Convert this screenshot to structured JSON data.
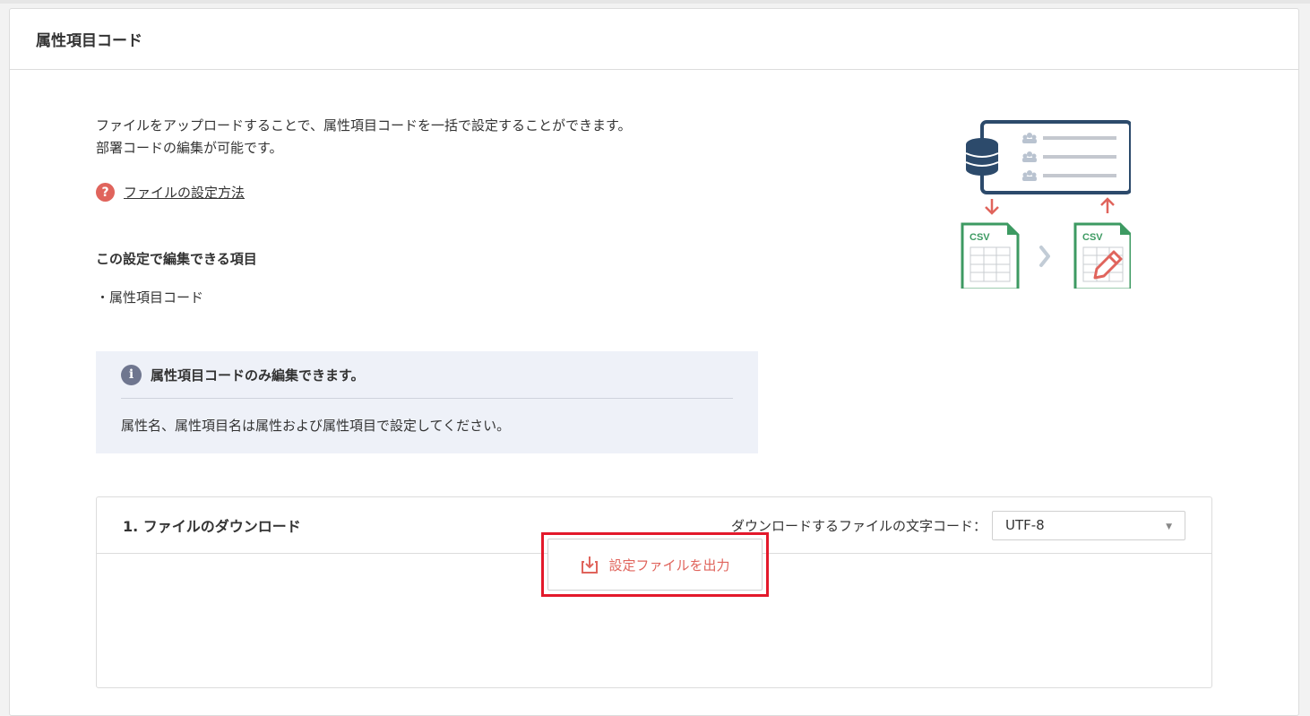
{
  "page": {
    "title": "属性項目コード"
  },
  "description": {
    "line1": "ファイルをアップロードすることで、属性項目コードを一括で設定することができます。",
    "line2": "部署コードの編集が可能です。"
  },
  "help": {
    "icon": "question-circle-icon",
    "link_label": "ファイルの設定方法"
  },
  "editable": {
    "heading": "この設定で編集できる項目",
    "items": [
      "・属性項目コード"
    ]
  },
  "info": {
    "icon": "info-circle-icon",
    "title": "属性項目コードのみ編集できます。",
    "text": "属性名、属性項目名は属性および属性項目で設定してください。"
  },
  "illustration": {
    "csv_label": "CSV"
  },
  "download": {
    "heading": "1. ファイルのダウンロード",
    "encoding_label": "ダウンロードするファイルの文字コード：",
    "encoding_value": "UTF-8",
    "export_label": "設定ファイルを出力",
    "export_icon": "download-icon"
  },
  "colors": {
    "accent_red": "#e0645c",
    "highlight_red": "#e3192b",
    "navy": "#2c4a6b",
    "csv_green": "#3d9a62",
    "info_bg": "#eef1f8"
  }
}
